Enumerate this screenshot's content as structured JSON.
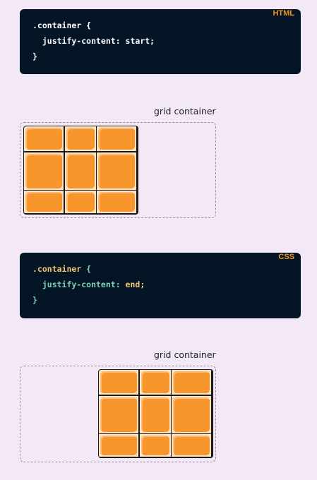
{
  "example1": {
    "lang": "HTML",
    "line1": ".container {",
    "line2": "  justify-content: start;",
    "line3": "}",
    "grid_label": "grid container"
  },
  "example2": {
    "lang": "CSS",
    "selector": ".container",
    "open_brace": " {",
    "property": "  justify-content:",
    "value": " end;",
    "close_brace": "}",
    "grid_label": "grid container"
  },
  "colors": {
    "page_bg": "#f3e9f6",
    "code_bg": "#041526",
    "accent_orange": "#f7931e",
    "item_orange": "#f7962d",
    "code_yellow": "#f6c66b",
    "code_teal": "#7fd1b9"
  }
}
